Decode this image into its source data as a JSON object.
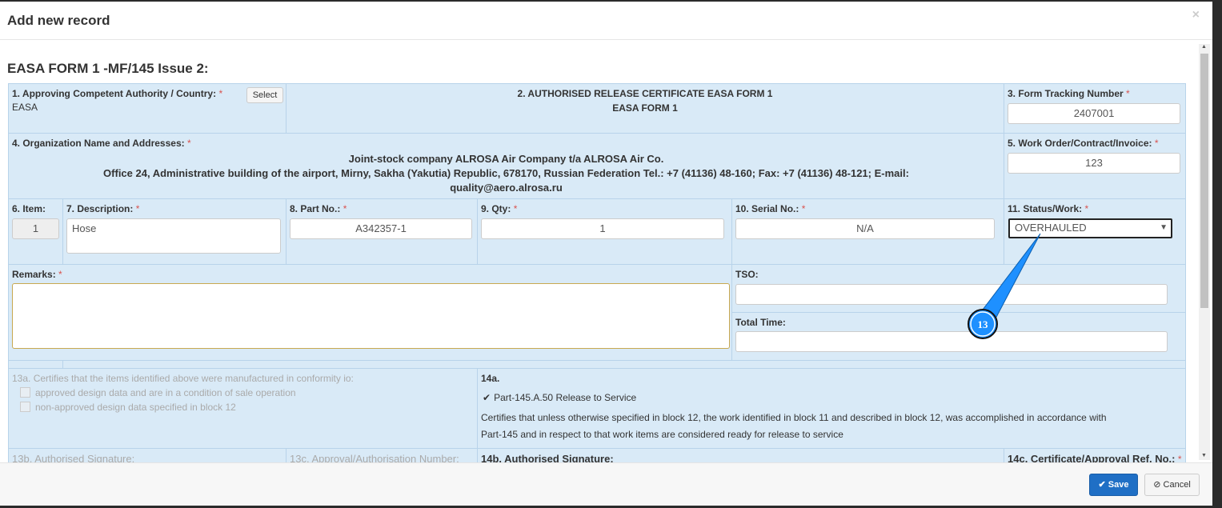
{
  "modal": {
    "title": "Add new record",
    "close": "×"
  },
  "form": {
    "title": "EASA FORM 1 -MF/145 Issue 2:",
    "f1": {
      "label": "1. Approving Competent Authority / Country:",
      "value": "EASA",
      "select": "Select"
    },
    "f2": {
      "label": "2. AUTHORISED RELEASE CERTIFICATE EASA FORM 1",
      "value": "EASA FORM 1"
    },
    "f3": {
      "label": "3. Form Tracking Number",
      "value": "2407001"
    },
    "f4": {
      "label": "4. Organization Name and Addresses:",
      "line1": "Joint-stock company ALROSA Air Company t/a ALROSA Air Co.",
      "line2": "Office 24, Administrative building of the airport, Mirny, Sakha (Yakutia) Republic, 678170, Russian Federation Tel.: +7 (41136) 48-160; Fax: +7 (41136) 48-121; E-mail:",
      "line3": "quality@aero.alrosa.ru"
    },
    "f5": {
      "label": "5. Work Order/Contract/Invoice:",
      "value": "123"
    },
    "f6": {
      "label": "6. Item:",
      "value": "1"
    },
    "f7": {
      "label": "7. Description:",
      "value": "Hose"
    },
    "f8": {
      "label": "8. Part No.:",
      "value": "A342357-1"
    },
    "f9": {
      "label": "9. Qty:",
      "value": "1"
    },
    "f10": {
      "label": "10. Serial No.:",
      "value": "N/A"
    },
    "f11": {
      "label": "11. Status/Work:",
      "value": "OVERHAULED"
    },
    "remarks": {
      "label": "Remarks:",
      "value": ""
    },
    "tso": {
      "label": "TSO:",
      "value": ""
    },
    "total_time": {
      "label": "Total Time:",
      "value": ""
    },
    "f13a": {
      "label": "13a. Certifies that the items identified above were manufactured in conformity io:",
      "opt1": "approved design data and are in a condition of sale operation",
      "opt2": "non-approved design data specified in block 12"
    },
    "f14a": {
      "label": "14a.",
      "check": "Part-145.A.50 Release to Service",
      "text1": "Certifies that unless otherwise specified in block 12, the work identified in block 11 and described in block 12, was accomplished in accordance with",
      "text2": "Part-145 and in respect to that work items are considered ready for release to service"
    },
    "f13b": {
      "label": "13b. Authorised Signature:"
    },
    "f13c": {
      "label": "13c. Approval/Authorisation Number:"
    },
    "f14b": {
      "label": "14b. Authorised Signature:"
    },
    "f14c": {
      "label": "14c. Certificate/Approval Ref. No.:"
    },
    "req": "*"
  },
  "footer": {
    "save": "Save",
    "cancel": "Cancel"
  },
  "annotation": {
    "number": "13"
  }
}
